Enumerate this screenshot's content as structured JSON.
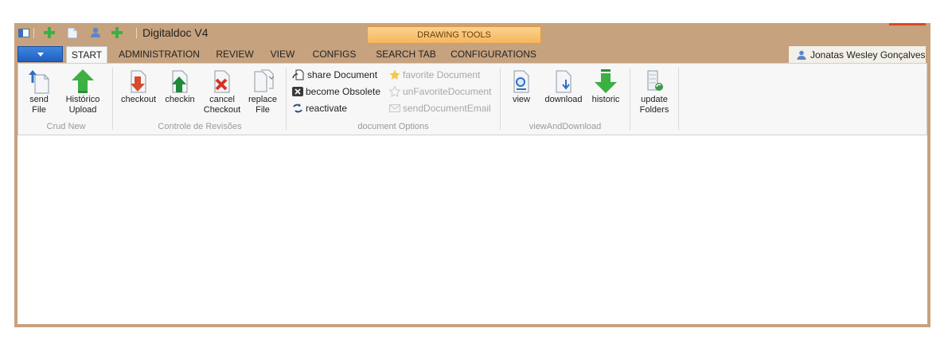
{
  "title": {
    "app_title": "Digitaldoc V4",
    "contextual_tab": "DRAWING TOOLS"
  },
  "tabs": [
    "START",
    "ADMINISTRATION",
    "REVIEW",
    "VIEW",
    "CONFIGS",
    "SEARCH TAB",
    "CONFIGURATIONS"
  ],
  "active_tab": "START",
  "user": {
    "name": "Jonatas Wesley Gonçalves"
  },
  "ribbon": {
    "crud_new": {
      "label": "Crud New",
      "send_file": {
        "line1": "send",
        "line2": "File"
      },
      "historico_upload": {
        "line1": "Histórico",
        "line2": "Upload"
      }
    },
    "controle": {
      "label": "Controle de Revisões",
      "checkout": "checkout",
      "checkin": "checkin",
      "cancel_checkout": {
        "line1": "cancel",
        "line2": "Checkout"
      },
      "replace_file": {
        "line1": "replace",
        "line2": "File"
      }
    },
    "document_options": {
      "label": "document Options",
      "share_document": "share Document",
      "become_obsolete": "become Obsolete",
      "reactivate": "reactivate",
      "favorite_document": "favorite Document",
      "unfavorite_document": "unFavoriteDocument",
      "send_document_email": "sendDocumentEmail"
    },
    "view_and_download": {
      "label": "viewAndDownload",
      "view": "view",
      "download": "download",
      "historic": "historic"
    },
    "update_folders": {
      "line1": "update",
      "line2": "Folders"
    }
  },
  "colors": {
    "frame": "#c6a27e",
    "accent_blue": "#1f5fc2",
    "green": "#3cb043",
    "red": "#d84a2e",
    "contextual_orange": "#f6b65d"
  }
}
